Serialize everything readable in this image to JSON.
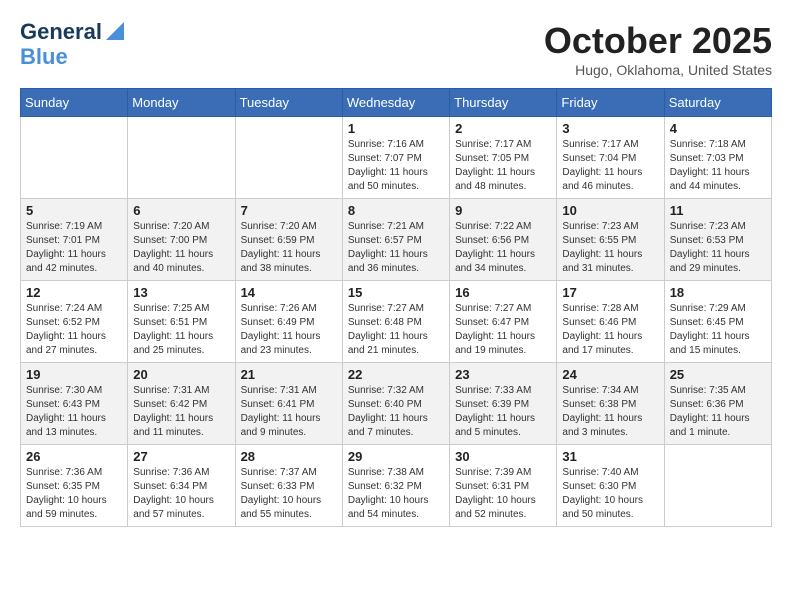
{
  "header": {
    "logo_line1": "General",
    "logo_line2": "Blue",
    "month": "October 2025",
    "location": "Hugo, Oklahoma, United States"
  },
  "days_of_week": [
    "Sunday",
    "Monday",
    "Tuesday",
    "Wednesday",
    "Thursday",
    "Friday",
    "Saturday"
  ],
  "weeks": [
    [
      {
        "day": "",
        "info": ""
      },
      {
        "day": "",
        "info": ""
      },
      {
        "day": "",
        "info": ""
      },
      {
        "day": "1",
        "info": "Sunrise: 7:16 AM\nSunset: 7:07 PM\nDaylight: 11 hours\nand 50 minutes."
      },
      {
        "day": "2",
        "info": "Sunrise: 7:17 AM\nSunset: 7:05 PM\nDaylight: 11 hours\nand 48 minutes."
      },
      {
        "day": "3",
        "info": "Sunrise: 7:17 AM\nSunset: 7:04 PM\nDaylight: 11 hours\nand 46 minutes."
      },
      {
        "day": "4",
        "info": "Sunrise: 7:18 AM\nSunset: 7:03 PM\nDaylight: 11 hours\nand 44 minutes."
      }
    ],
    [
      {
        "day": "5",
        "info": "Sunrise: 7:19 AM\nSunset: 7:01 PM\nDaylight: 11 hours\nand 42 minutes."
      },
      {
        "day": "6",
        "info": "Sunrise: 7:20 AM\nSunset: 7:00 PM\nDaylight: 11 hours\nand 40 minutes."
      },
      {
        "day": "7",
        "info": "Sunrise: 7:20 AM\nSunset: 6:59 PM\nDaylight: 11 hours\nand 38 minutes."
      },
      {
        "day": "8",
        "info": "Sunrise: 7:21 AM\nSunset: 6:57 PM\nDaylight: 11 hours\nand 36 minutes."
      },
      {
        "day": "9",
        "info": "Sunrise: 7:22 AM\nSunset: 6:56 PM\nDaylight: 11 hours\nand 34 minutes."
      },
      {
        "day": "10",
        "info": "Sunrise: 7:23 AM\nSunset: 6:55 PM\nDaylight: 11 hours\nand 31 minutes."
      },
      {
        "day": "11",
        "info": "Sunrise: 7:23 AM\nSunset: 6:53 PM\nDaylight: 11 hours\nand 29 minutes."
      }
    ],
    [
      {
        "day": "12",
        "info": "Sunrise: 7:24 AM\nSunset: 6:52 PM\nDaylight: 11 hours\nand 27 minutes."
      },
      {
        "day": "13",
        "info": "Sunrise: 7:25 AM\nSunset: 6:51 PM\nDaylight: 11 hours\nand 25 minutes."
      },
      {
        "day": "14",
        "info": "Sunrise: 7:26 AM\nSunset: 6:49 PM\nDaylight: 11 hours\nand 23 minutes."
      },
      {
        "day": "15",
        "info": "Sunrise: 7:27 AM\nSunset: 6:48 PM\nDaylight: 11 hours\nand 21 minutes."
      },
      {
        "day": "16",
        "info": "Sunrise: 7:27 AM\nSunset: 6:47 PM\nDaylight: 11 hours\nand 19 minutes."
      },
      {
        "day": "17",
        "info": "Sunrise: 7:28 AM\nSunset: 6:46 PM\nDaylight: 11 hours\nand 17 minutes."
      },
      {
        "day": "18",
        "info": "Sunrise: 7:29 AM\nSunset: 6:45 PM\nDaylight: 11 hours\nand 15 minutes."
      }
    ],
    [
      {
        "day": "19",
        "info": "Sunrise: 7:30 AM\nSunset: 6:43 PM\nDaylight: 11 hours\nand 13 minutes."
      },
      {
        "day": "20",
        "info": "Sunrise: 7:31 AM\nSunset: 6:42 PM\nDaylight: 11 hours\nand 11 minutes."
      },
      {
        "day": "21",
        "info": "Sunrise: 7:31 AM\nSunset: 6:41 PM\nDaylight: 11 hours\nand 9 minutes."
      },
      {
        "day": "22",
        "info": "Sunrise: 7:32 AM\nSunset: 6:40 PM\nDaylight: 11 hours\nand 7 minutes."
      },
      {
        "day": "23",
        "info": "Sunrise: 7:33 AM\nSunset: 6:39 PM\nDaylight: 11 hours\nand 5 minutes."
      },
      {
        "day": "24",
        "info": "Sunrise: 7:34 AM\nSunset: 6:38 PM\nDaylight: 11 hours\nand 3 minutes."
      },
      {
        "day": "25",
        "info": "Sunrise: 7:35 AM\nSunset: 6:36 PM\nDaylight: 11 hours\nand 1 minute."
      }
    ],
    [
      {
        "day": "26",
        "info": "Sunrise: 7:36 AM\nSunset: 6:35 PM\nDaylight: 10 hours\nand 59 minutes."
      },
      {
        "day": "27",
        "info": "Sunrise: 7:36 AM\nSunset: 6:34 PM\nDaylight: 10 hours\nand 57 minutes."
      },
      {
        "day": "28",
        "info": "Sunrise: 7:37 AM\nSunset: 6:33 PM\nDaylight: 10 hours\nand 55 minutes."
      },
      {
        "day": "29",
        "info": "Sunrise: 7:38 AM\nSunset: 6:32 PM\nDaylight: 10 hours\nand 54 minutes."
      },
      {
        "day": "30",
        "info": "Sunrise: 7:39 AM\nSunset: 6:31 PM\nDaylight: 10 hours\nand 52 minutes."
      },
      {
        "day": "31",
        "info": "Sunrise: 7:40 AM\nSunset: 6:30 PM\nDaylight: 10 hours\nand 50 minutes."
      },
      {
        "day": "",
        "info": ""
      }
    ]
  ]
}
